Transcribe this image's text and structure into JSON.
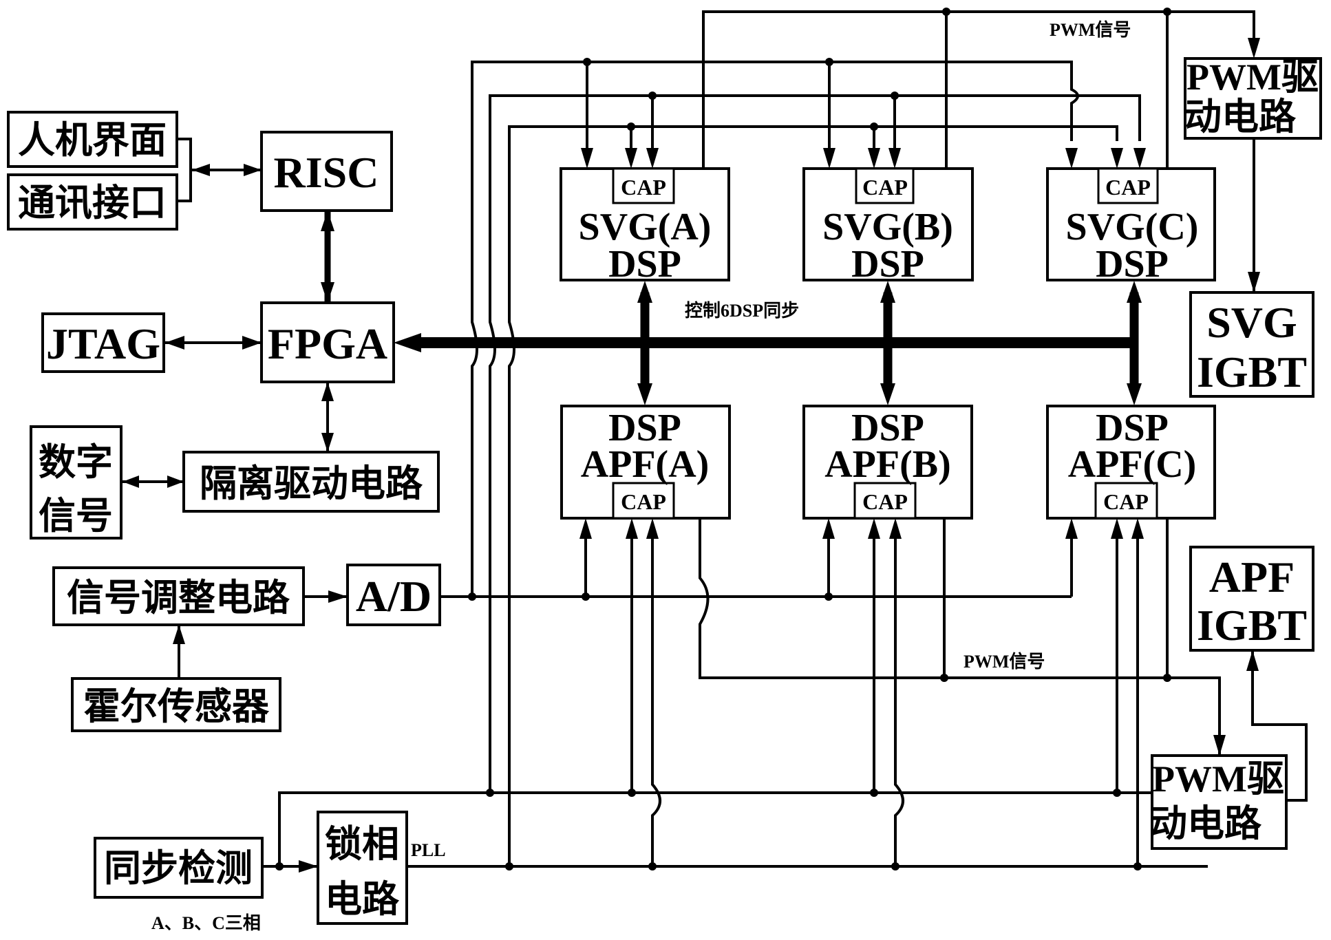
{
  "diagram": {
    "blocks": {
      "hmi": "人机界面",
      "comm": "通讯接口",
      "risc": "RISC",
      "fpga": "FPGA",
      "jtag": "JTAG",
      "digital_signal_1": "数字",
      "digital_signal_2": "信号",
      "isolation_driver": "隔离驱动电路",
      "signal_conditioning": "信号调整电路",
      "ad": "A/D",
      "hall_sensor": "霍尔传感器",
      "sync_detect": "同步检测",
      "pll_circuit_1": "锁相",
      "pll_circuit_2": "电路",
      "svg_a_1": "SVG(A)",
      "svg_a_2": "DSP",
      "svg_b_1": "SVG(B)",
      "svg_b_2": "DSP",
      "svg_c_1": "SVG(C)",
      "svg_c_2": "DSP",
      "apf_a_1": "DSP",
      "apf_a_2": "APF(A)",
      "apf_b_1": "DSP",
      "apf_b_2": "APF(B)",
      "apf_c_1": "DSP",
      "apf_c_2": "APF(C)",
      "cap": "CAP",
      "pwm_driver_top_1": "PWM驱",
      "pwm_driver_top_2": "动电路",
      "pwm_driver_bottom_1": "PWM驱",
      "pwm_driver_bottom_2": "动电路",
      "svg_igbt_1": "SVG",
      "svg_igbt_2": "IGBT",
      "apf_igbt_1": "APF",
      "apf_igbt_2": "IGBT"
    },
    "labels": {
      "pwm_signal_top": "PWM信号",
      "pwm_signal_bottom": "PWM信号",
      "sync_bus": "控制6DSP同步",
      "pll": "PLL",
      "three_phase": "A、B、C三相"
    }
  }
}
